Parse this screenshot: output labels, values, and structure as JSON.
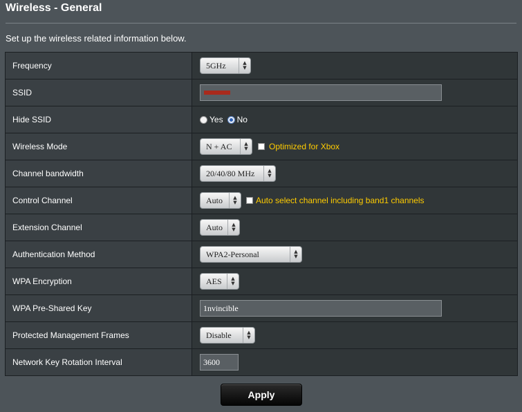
{
  "page": {
    "title": "Wireless - General",
    "subtitle": "Set up the wireless related information below."
  },
  "rows": {
    "frequency": {
      "label": "Frequency",
      "value": "5GHz"
    },
    "ssid": {
      "label": "SSID",
      "value": ""
    },
    "hide_ssid": {
      "label": "Hide SSID",
      "yes": "Yes",
      "no": "No",
      "selected": "No"
    },
    "wireless_mode": {
      "label": "Wireless Mode",
      "value": "N + AC",
      "checkbox_label": "Optimized for Xbox",
      "checked": false
    },
    "channel_bandwidth": {
      "label": "Channel bandwidth",
      "value": "20/40/80 MHz"
    },
    "control_channel": {
      "label": "Control Channel",
      "value": "Auto",
      "checkbox_label": "Auto select channel including band1 channels",
      "checked": false
    },
    "extension_channel": {
      "label": "Extension Channel",
      "value": "Auto"
    },
    "auth_method": {
      "label": "Authentication Method",
      "value": "WPA2-Personal"
    },
    "wpa_encryption": {
      "label": "WPA Encryption",
      "value": "AES"
    },
    "psk": {
      "label": "WPA Pre-Shared Key",
      "value": "1nvincible"
    },
    "pmf": {
      "label": "Protected Management Frames",
      "value": "Disable"
    },
    "key_rotation": {
      "label": "Network Key Rotation Interval",
      "value": "3600"
    }
  },
  "actions": {
    "apply_label": "Apply"
  },
  "icons": {
    "select_arrows": "up-down-arrows-icon"
  },
  "colors": {
    "accent_yellow": "#ffcc00",
    "background": "#4d5459",
    "redaction": "#a92a1c"
  }
}
